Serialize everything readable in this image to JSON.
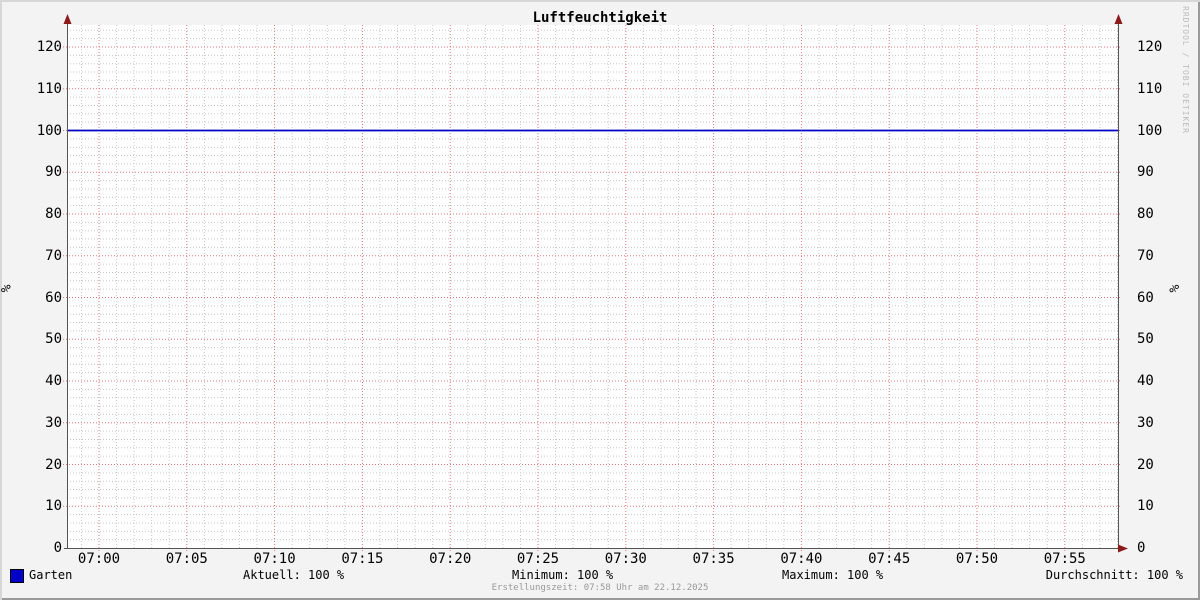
{
  "title": "Luftfeuchtigkeit",
  "chart_data": {
    "type": "line",
    "title": "Luftfeuchtigkeit",
    "xlabel": "",
    "ylabel_left": "%",
    "ylabel_right": "%",
    "ylim": [
      0,
      125.5
    ],
    "y_major_step": 10,
    "y_minor_step": 2,
    "x_major_ticks": [
      "07:00",
      "07:05",
      "07:10",
      "07:15",
      "07:20",
      "07:25",
      "07:30",
      "07:35",
      "07:40",
      "07:45",
      "07:50",
      "07:55"
    ],
    "x_minor_per_major": 5,
    "grid": true,
    "legend_position": "bottom",
    "series": [
      {
        "name": "Garten",
        "color": "#0000c8",
        "type": "constant-line",
        "value": 100
      }
    ]
  },
  "legend": {
    "series_swatch_color": "#0000c8",
    "series_label": "Garten",
    "stats": {
      "aktuell": "Aktuell: 100 %",
      "minimum": "Minimum: 100 %",
      "maximum": "Maximum: 100 %",
      "durchschnitt": "Durchschnitt: 100 %"
    }
  },
  "footer": {
    "text": "Erstellungszeit: 07:58 Uhr am 22.12.2025"
  },
  "watermark": {
    "text": "RRDTOOL / TOBI OETIKER"
  },
  "colors": {
    "background": "#f3f3f3",
    "canvas": "#ffffff",
    "major_grid": "#e07a7a",
    "minor_grid": "#c9c9c9",
    "axis": "#555555",
    "arrow": "#8b1a1a",
    "series_line": "#0000c8",
    "text": "#000000",
    "footer_text": "#999999",
    "watermark_text": "#bcbcbc"
  }
}
